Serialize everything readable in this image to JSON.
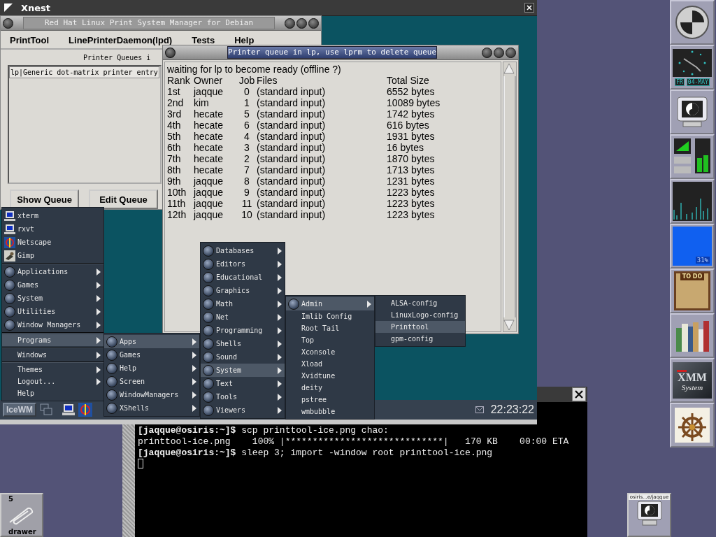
{
  "xnest": {
    "title": "Xnest"
  },
  "printtool": {
    "title": "Red Hat Linux Print System Manager for Debian",
    "menus": [
      "PrintTool",
      "LinePrinterDaemon(lpd)",
      "Tests",
      "Help"
    ],
    "queues_label": "Printer Queues i",
    "queues": [
      {
        "label": "lp|Generic dot-matrix printer entry",
        "selected": true
      }
    ],
    "buttons": [
      "Show Queue",
      "Edit Queue"
    ]
  },
  "queue_window": {
    "title": "Printer queue in lp, use lprm to delete queue",
    "status": "waiting for lp to become ready (offline ?)",
    "columns": [
      "Rank",
      "Owner",
      "Job",
      "Files",
      "Total Size"
    ],
    "rows": [
      [
        "1st",
        "jaqque",
        "0",
        "(standard input)",
        "6552 bytes"
      ],
      [
        "2nd",
        "kim",
        "1",
        "(standard input)",
        "10089 bytes"
      ],
      [
        "3rd",
        "hecate",
        "5",
        "(standard input)",
        "1742 bytes"
      ],
      [
        "4th",
        "hecate",
        "6",
        "(standard input)",
        "616 bytes"
      ],
      [
        "5th",
        "hecate",
        "4",
        "(standard input)",
        "1931 bytes"
      ],
      [
        "6th",
        "hecate",
        "3",
        "(standard input)",
        "16 bytes"
      ],
      [
        "7th",
        "hecate",
        "2",
        "(standard input)",
        "1870 bytes"
      ],
      [
        "8th",
        "hecate",
        "7",
        "(standard input)",
        "1713 bytes"
      ],
      [
        "9th",
        "jaqque",
        "8",
        "(standard input)",
        "1231 bytes"
      ],
      [
        "10th",
        "jaqque",
        "9",
        "(standard input)",
        "1223 bytes"
      ],
      [
        "11th",
        "jaqque",
        "11",
        "(standard input)",
        "1223 bytes"
      ],
      [
        "12th",
        "jaqque",
        "10",
        "(standard input)",
        "1223 bytes"
      ]
    ]
  },
  "menus": [
    {
      "sections": [
        [
          {
            "label": "xterm",
            "kind": "terminal",
            "submenu": false,
            "selected": false
          },
          {
            "label": "rxvt",
            "kind": "terminal",
            "submenu": false,
            "selected": false
          },
          {
            "label": "Netscape",
            "kind": "browser",
            "submenu": false,
            "selected": false
          },
          {
            "label": "Gimp",
            "kind": "paint",
            "submenu": false,
            "selected": false
          }
        ],
        [
          {
            "label": "Applications",
            "kind": "folder",
            "submenu": true,
            "selected": false
          },
          {
            "label": "Games",
            "kind": "folder",
            "submenu": true,
            "selected": false
          },
          {
            "label": "System",
            "kind": "folder",
            "submenu": true,
            "selected": false
          },
          {
            "label": "Utilities",
            "kind": "folder",
            "submenu": true,
            "selected": false
          },
          {
            "label": "Window Managers",
            "kind": "folder",
            "submenu": true,
            "selected": false
          }
        ],
        [
          {
            "label": "Programs",
            "kind": "plain",
            "submenu": true,
            "selected": true
          }
        ],
        [
          {
            "label": "Windows",
            "kind": "plain",
            "submenu": true,
            "selected": false
          }
        ],
        [
          {
            "label": "Themes",
            "kind": "plain",
            "submenu": true,
            "selected": false
          },
          {
            "label": "Logout...",
            "kind": "plain",
            "submenu": true,
            "selected": false
          },
          {
            "label": "Help",
            "kind": "plain",
            "submenu": false,
            "selected": false
          }
        ]
      ]
    },
    {
      "sections": [
        [
          {
            "label": "Apps",
            "kind": "folder",
            "submenu": true,
            "selected": true
          },
          {
            "label": "Games",
            "kind": "folder",
            "submenu": true,
            "selected": false
          },
          {
            "label": "Help",
            "kind": "folder",
            "submenu": true,
            "selected": false
          },
          {
            "label": "Screen",
            "kind": "folder",
            "submenu": true,
            "selected": false
          },
          {
            "label": "WindowManagers",
            "kind": "folder",
            "submenu": true,
            "selected": false
          },
          {
            "label": "XShells",
            "kind": "folder",
            "submenu": true,
            "selected": false
          }
        ]
      ]
    },
    {
      "sections": [
        [
          {
            "label": "Databases",
            "kind": "folder",
            "submenu": true,
            "selected": false
          },
          {
            "label": "Editors",
            "kind": "folder",
            "submenu": true,
            "selected": false
          },
          {
            "label": "Educational",
            "kind": "folder",
            "submenu": true,
            "selected": false
          },
          {
            "label": "Graphics",
            "kind": "folder",
            "submenu": true,
            "selected": false
          },
          {
            "label": "Math",
            "kind": "folder",
            "submenu": true,
            "selected": false
          },
          {
            "label": "Net",
            "kind": "folder",
            "submenu": true,
            "selected": false
          },
          {
            "label": "Programming",
            "kind": "folder",
            "submenu": true,
            "selected": false
          },
          {
            "label": "Shells",
            "kind": "folder",
            "submenu": true,
            "selected": false
          },
          {
            "label": "Sound",
            "kind": "folder",
            "submenu": true,
            "selected": false
          },
          {
            "label": "System",
            "kind": "folder",
            "submenu": true,
            "selected": true
          },
          {
            "label": "Text",
            "kind": "folder",
            "submenu": true,
            "selected": false
          },
          {
            "label": "Tools",
            "kind": "folder",
            "submenu": true,
            "selected": false
          },
          {
            "label": "Viewers",
            "kind": "folder",
            "submenu": true,
            "selected": false
          }
        ]
      ]
    },
    {
      "sections": [
        [
          {
            "label": "Admin",
            "kind": "folder",
            "submenu": true,
            "selected": true
          },
          {
            "label": "Imlib Config",
            "kind": "plain",
            "submenu": false,
            "selected": false
          },
          {
            "label": "Root Tail",
            "kind": "plain",
            "submenu": false,
            "selected": false
          },
          {
            "label": "Top",
            "kind": "plain",
            "submenu": false,
            "selected": false
          },
          {
            "label": "Xconsole",
            "kind": "plain",
            "submenu": false,
            "selected": false
          },
          {
            "label": "Xload",
            "kind": "plain",
            "submenu": false,
            "selected": false
          },
          {
            "label": "Xvidtune",
            "kind": "plain",
            "submenu": false,
            "selected": false
          },
          {
            "label": "deity",
            "kind": "plain",
            "submenu": false,
            "selected": false
          },
          {
            "label": "pstree",
            "kind": "plain",
            "submenu": false,
            "selected": false
          },
          {
            "label": "wmbubble",
            "kind": "plain",
            "submenu": false,
            "selected": false
          }
        ]
      ]
    },
    {
      "sections": [
        [
          {
            "label": "ALSA-config",
            "kind": "plain",
            "submenu": false,
            "selected": false
          },
          {
            "label": "LinuxLogo-config",
            "kind": "plain",
            "submenu": false,
            "selected": false
          },
          {
            "label": "Printtool",
            "kind": "plain",
            "submenu": false,
            "selected": true
          },
          {
            "label": "gpm-config",
            "kind": "plain",
            "submenu": false,
            "selected": false
          }
        ]
      ]
    }
  ],
  "taskbar": {
    "start": "IceWM",
    "clock": "22:23:22"
  },
  "terminal": {
    "lines": [
      {
        "prompt": "[jaqque@osiris:~]$",
        "text": " scp printtool-ice.png chao:"
      },
      {
        "text": "printtool-ice.png    100% |*****************************|   170 KB    00:00 ETA"
      },
      {
        "prompt": "[jaqque@osiris:~]$",
        "text": " sleep 3; import -window root printtool-ice.png"
      }
    ]
  },
  "dock": [
    {
      "kind": "disc"
    },
    {
      "kind": "clock",
      "day": "FR",
      "date": "04-MAY"
    },
    {
      "kind": "monitor"
    },
    {
      "kind": "mixer"
    },
    {
      "kind": "load"
    },
    {
      "kind": "cpu",
      "reading": "31%"
    },
    {
      "kind": "todo",
      "label": "TO DO"
    },
    {
      "kind": "books"
    },
    {
      "kind": "xmm",
      "label": "XMM",
      "sub": "System"
    },
    {
      "kind": "wheel"
    }
  ],
  "drawer": {
    "count": "5",
    "label": "drawer"
  },
  "mini_window": {
    "label": "osiris...e/jaqque"
  }
}
